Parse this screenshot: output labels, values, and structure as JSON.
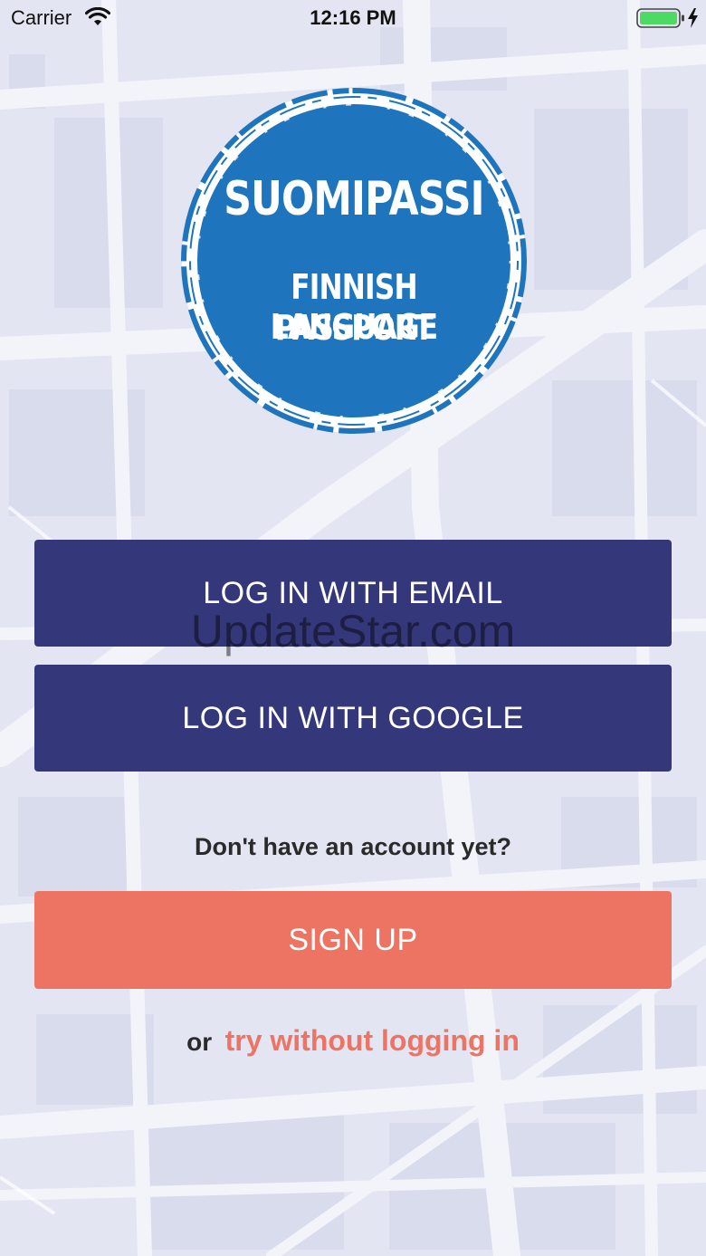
{
  "status_bar": {
    "carrier": "Carrier",
    "time": "12:16 PM",
    "wifi_icon": "wifi-icon",
    "battery_icon": "battery-charging-icon",
    "battery_color": "#4cd964"
  },
  "logo": {
    "title": "SUOMIPASSI",
    "subtitle_line1": "FINNISH LANGUAGE",
    "subtitle_line2": "PASSPORT",
    "circle_color": "#1f75bd"
  },
  "login": {
    "email_label": "LOG IN WITH EMAIL",
    "google_label": "LOG IN WITH GOOGLE",
    "button_color": "#35377b"
  },
  "signup": {
    "prompt": "Don't have an account yet?",
    "button_label": "SIGN UP",
    "button_color": "#ed7462"
  },
  "guest": {
    "or_text": "or",
    "link_text": "try without logging in"
  },
  "watermark": "UpdateStar.com"
}
